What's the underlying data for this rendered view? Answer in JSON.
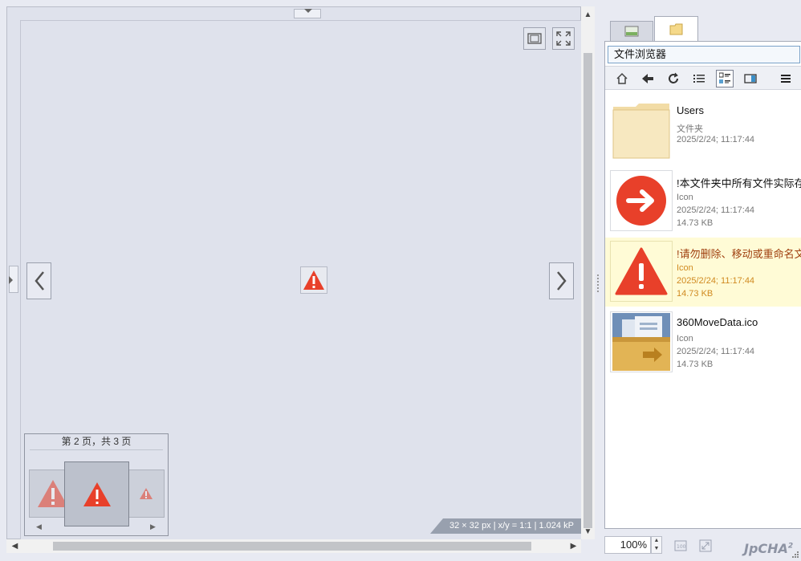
{
  "viewer": {
    "page_indicator": "第 2 页，共 3 页",
    "status": "32 × 32 px | x/y = 1:1 | 1.024 kP"
  },
  "panel": {
    "title": "文件浏览器",
    "files": [
      {
        "name": "Users",
        "type": "文件夹",
        "date": "2025/2/24; 11:17:44",
        "size": ""
      },
      {
        "name": "!本文件夹中所有文件实际存放",
        "type": "Icon",
        "date": "2025/2/24; 11:17:44",
        "size": "14.73 KB"
      },
      {
        "name": "!请勿删除、移动或重命名文件",
        "type": "Icon",
        "date": "2025/2/24; 11:17:44",
        "size": "14.73 KB"
      },
      {
        "name": "360MoveData.ico",
        "type": "Icon",
        "date": "2025/2/24; 11:17:44",
        "size": "14.73 KB"
      }
    ]
  },
  "zoom": {
    "value": "100%"
  },
  "brand": {
    "name": "JpCHA",
    "sup": "2"
  },
  "colors": {
    "warning_red": "#e8402a",
    "highlight_bg": "#fffbd6",
    "status_bar": "#98a0ae"
  },
  "icons": [
    "fit-window-icon",
    "fullscreen-icon",
    "chevron-left-icon",
    "chevron-right-icon",
    "warning-icon",
    "image-tab-icon",
    "folder-tab-icon",
    "home-icon",
    "back-icon",
    "refresh-icon",
    "list-view-icon",
    "details-view-icon",
    "preview-icon",
    "menu-icon",
    "arrow-right-circle-icon",
    "folder-icon"
  ]
}
